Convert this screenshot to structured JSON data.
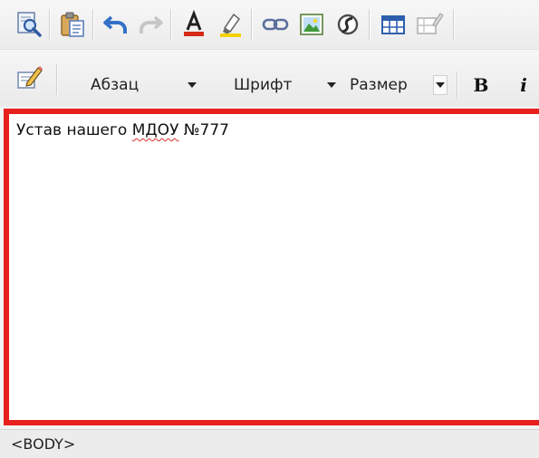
{
  "toolbar_row1": {
    "buttons": [
      {
        "icon": "preview-icon"
      },
      {
        "icon": "paste-icon"
      },
      {
        "icon": "undo-icon"
      },
      {
        "icon": "redo-icon"
      },
      {
        "icon": "text-color-icon"
      },
      {
        "icon": "highlight-color-icon"
      },
      {
        "icon": "link-icon"
      },
      {
        "icon": "image-icon"
      },
      {
        "icon": "flash-icon"
      },
      {
        "icon": "table-icon"
      },
      {
        "icon": "table-edit-icon"
      }
    ]
  },
  "toolbar_row2": {
    "edit_icon": "edit-source-icon",
    "paragraph_combo": {
      "label": "Абзац"
    },
    "font_combo": {
      "label": "Шрифт"
    },
    "size_combo": {
      "label": "Размер"
    },
    "bold_label": "B",
    "italic_label": "i"
  },
  "editor": {
    "text_before": "Устав нашего ",
    "text_misspelled": "МДОУ",
    "text_after": " №777"
  },
  "status": {
    "path": "<BODY>"
  },
  "colors": {
    "editor_border": "#e8201e",
    "spellcheck_underline": "#d43030",
    "toolbar_bg": "#f0f0f0"
  }
}
